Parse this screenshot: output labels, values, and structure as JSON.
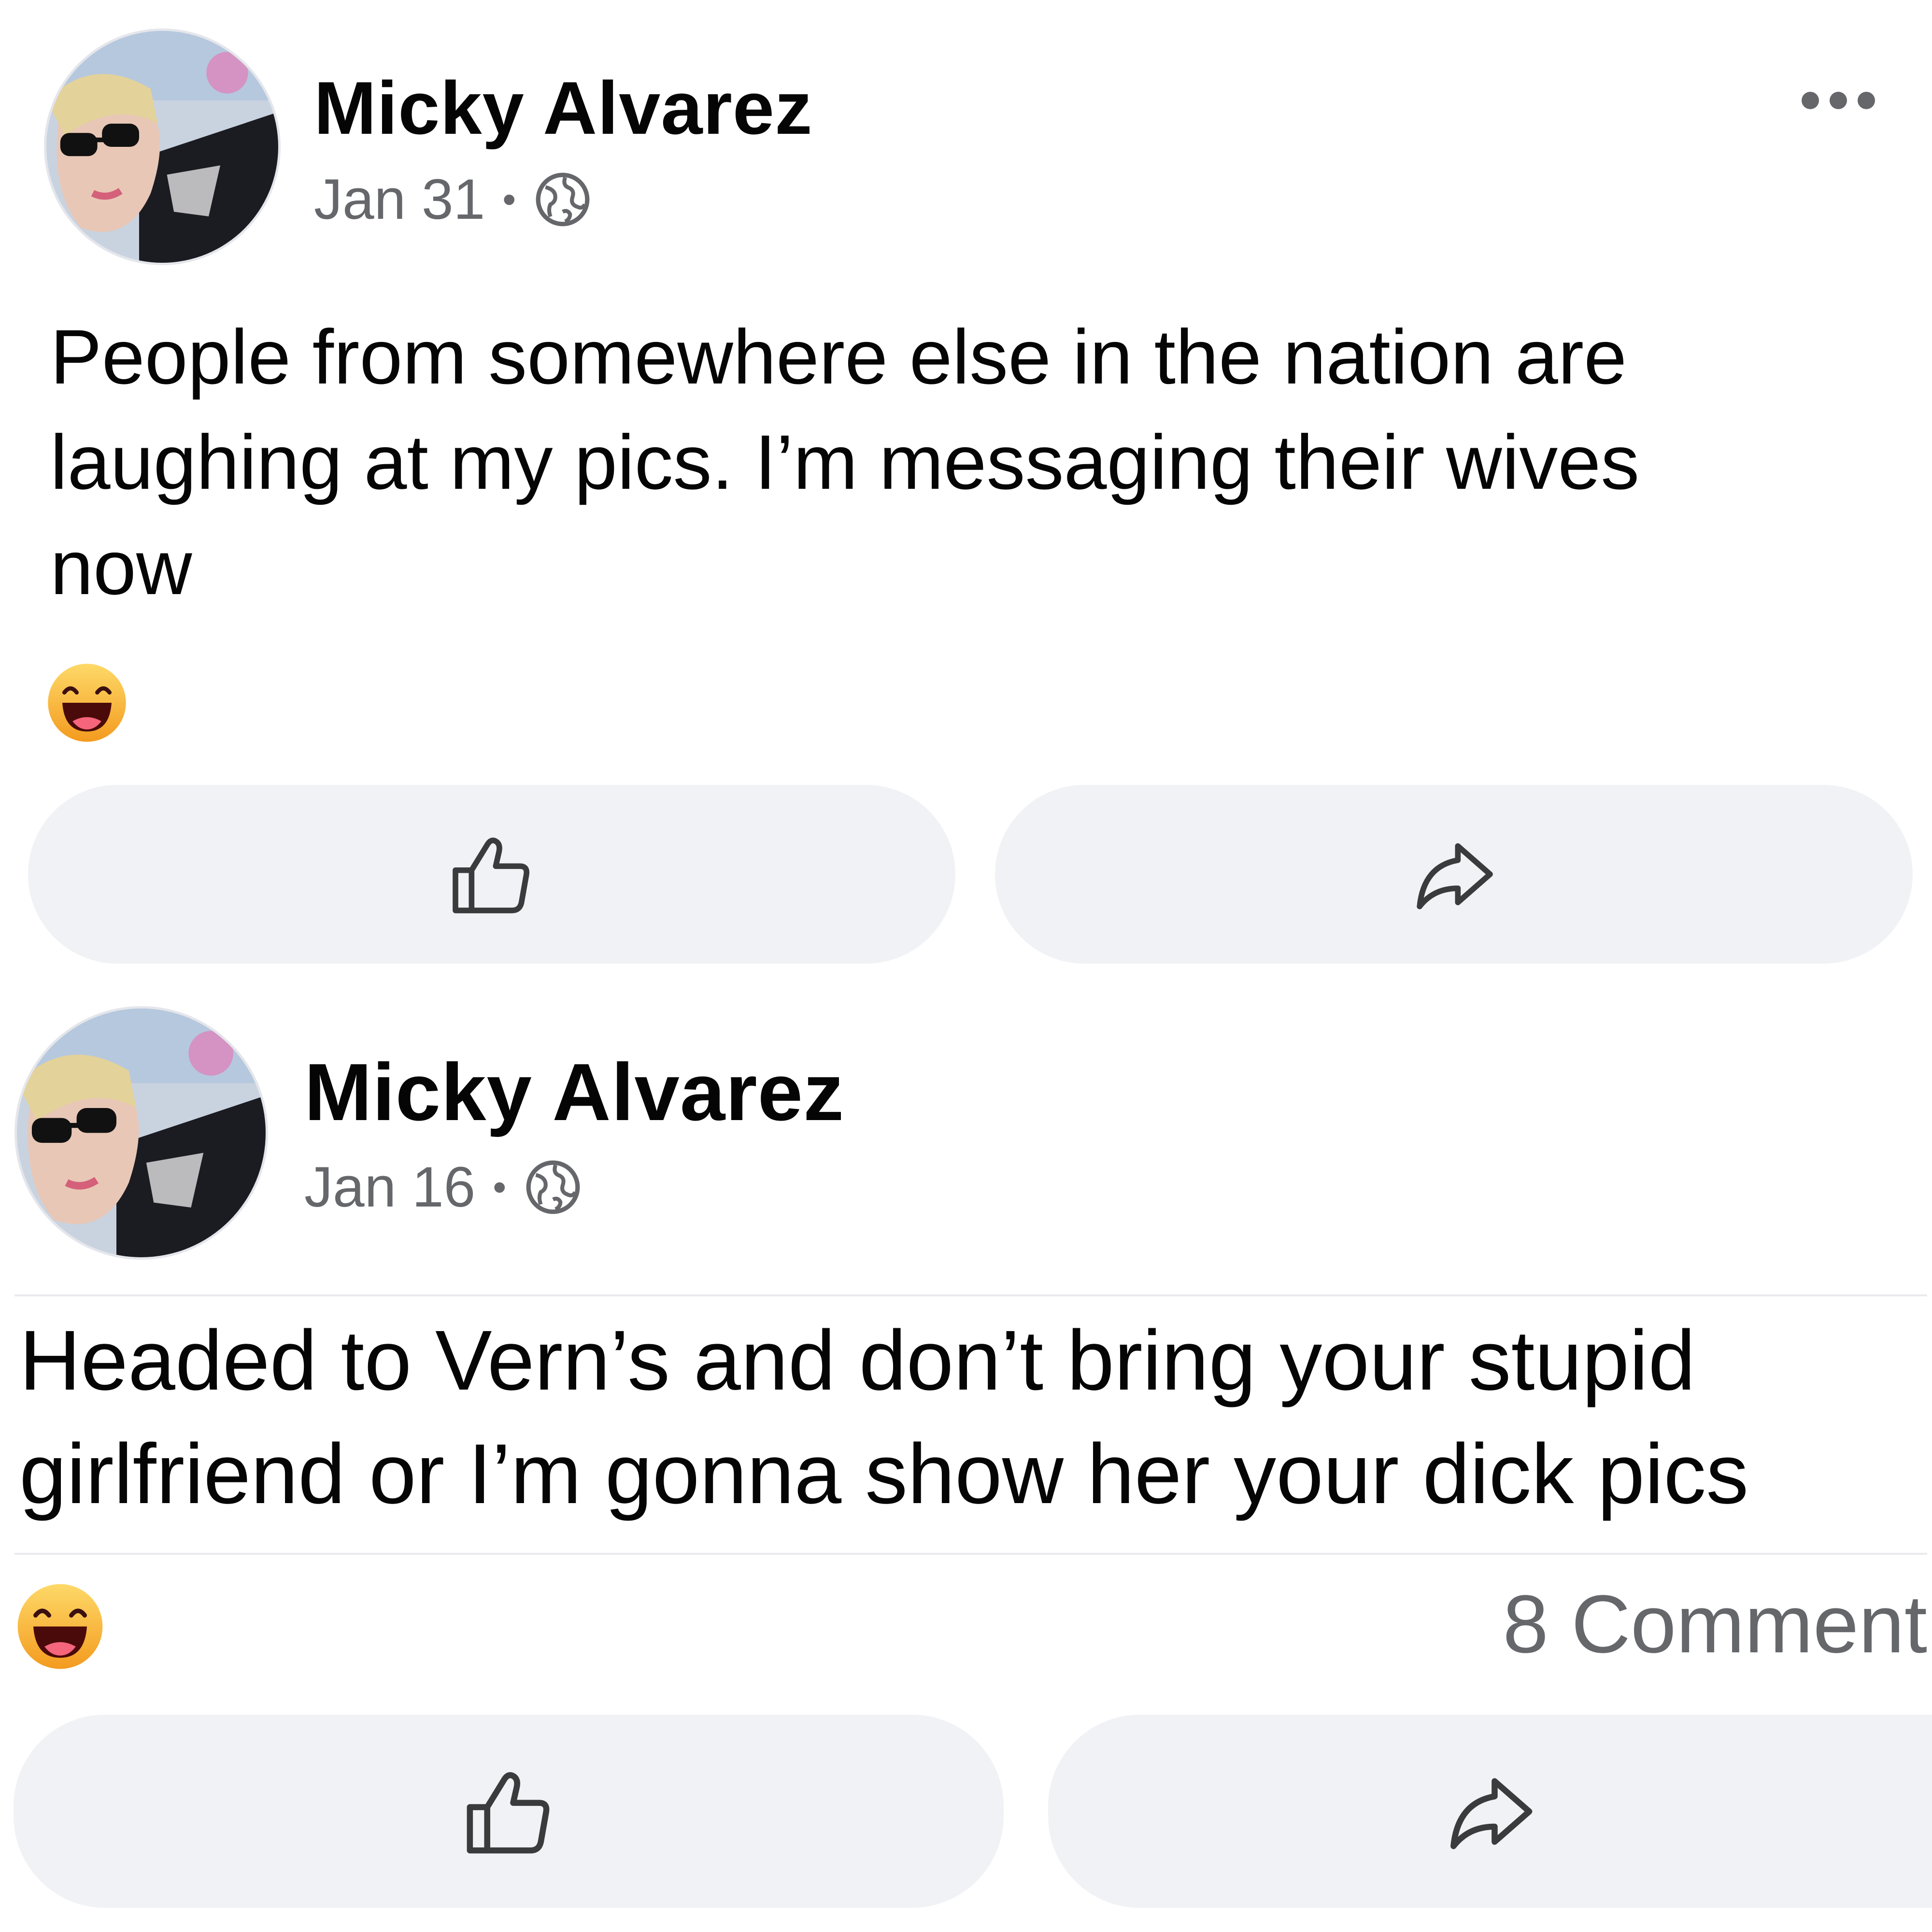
{
  "posts": [
    {
      "author": "Micky Alvarez",
      "date": "Jan 31",
      "separator": "•",
      "audience_icon": "globe-icon",
      "text_lines": [
        "People from somewhere else in the nation are",
        "laughing at my pics. I’m messaging their wives",
        "now"
      ],
      "reaction_icon": "haha-reaction-icon",
      "actions": [
        "like-icon",
        "share-icon"
      ]
    },
    {
      "author": "Micky Alvarez",
      "date": "Jan 16",
      "separator": "•",
      "audience_icon": "globe-icon",
      "text_lines": [
        "Headed to Vern’s and don’t bring your stupid",
        "girlfriend or I’m gonna show her your dick pics"
      ],
      "reaction_icon": "haha-reaction-icon",
      "comments": "8 Comment",
      "actions": [
        "like-icon",
        "share-icon"
      ]
    }
  ],
  "colors": {
    "text_primary": "#050505",
    "text_secondary": "#65676b",
    "button_background": "#f0f2f5",
    "haha_yellow": "#f7b125",
    "haha_mouth": "#4b0a0a"
  }
}
